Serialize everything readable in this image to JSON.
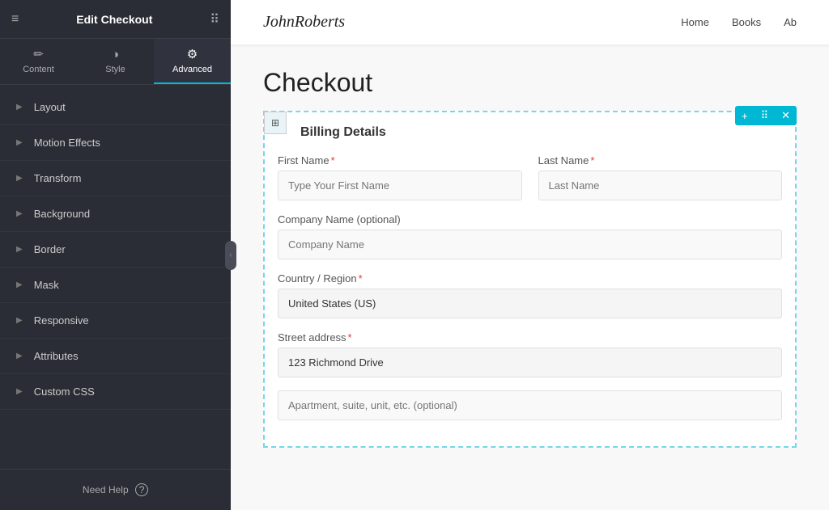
{
  "topbar": {
    "title": "Edit Checkout",
    "hamburger": "≡",
    "grid": "⠿"
  },
  "tabs": [
    {
      "id": "content",
      "label": "Content",
      "icon": "✏️",
      "active": false
    },
    {
      "id": "style",
      "label": "Style",
      "icon": "◑",
      "active": false
    },
    {
      "id": "advanced",
      "label": "Advanced",
      "icon": "⚙",
      "active": true
    }
  ],
  "menu_items": [
    {
      "label": "Layout"
    },
    {
      "label": "Motion Effects"
    },
    {
      "label": "Transform"
    },
    {
      "label": "Background"
    },
    {
      "label": "Border"
    },
    {
      "label": "Mask"
    },
    {
      "label": "Responsive"
    },
    {
      "label": "Attributes"
    },
    {
      "label": "Custom CSS"
    }
  ],
  "help": {
    "label": "Need Help",
    "icon": "?"
  },
  "nav": {
    "brand": "JohnRoberts",
    "links": [
      "Home",
      "Books",
      "Ab"
    ]
  },
  "page": {
    "title": "Checkout"
  },
  "actions": {
    "add": "+",
    "move": "⠿",
    "close": "✕"
  },
  "form": {
    "section_title": "Billing Details",
    "fields": [
      {
        "id": "first_name",
        "label": "First Name",
        "required": true,
        "placeholder": "Type Your First Name",
        "value": ""
      },
      {
        "id": "last_name",
        "label": "Last Name",
        "required": true,
        "placeholder": "Last Name",
        "value": ""
      },
      {
        "id": "company_name",
        "label": "Company Name (optional)",
        "required": false,
        "placeholder": "Company Name",
        "value": ""
      },
      {
        "id": "country",
        "label": "Country / Region",
        "required": true,
        "placeholder": "",
        "value": "United States (US)"
      },
      {
        "id": "street_address",
        "label": "Street address",
        "required": true,
        "placeholder": "",
        "value": "123 Richmond Drive"
      },
      {
        "id": "apartment",
        "label": "",
        "required": false,
        "placeholder": "Apartment, suite, unit, etc. (optional)",
        "value": ""
      }
    ]
  }
}
